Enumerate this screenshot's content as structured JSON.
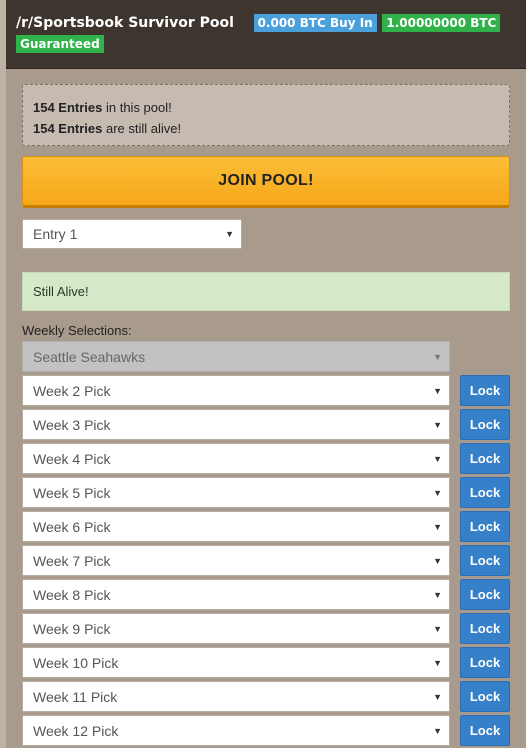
{
  "header": {
    "title": "/r/Sportsbook Survivor Pool",
    "buy_in": "0.000 BTC Buy In",
    "guaranteed_amount": "1.00000000 BTC",
    "guaranteed_label": "Guaranteed"
  },
  "info": {
    "entries_count": "154 Entries",
    "entries_text": " in this pool!",
    "alive_count": "154 Entries",
    "alive_text": " are still alive!"
  },
  "join_button": "JOIN POOL!",
  "entry_select": {
    "selected": "Entry 1"
  },
  "status": "Still Alive!",
  "weekly": {
    "label": "Weekly Selections:",
    "locked_pick": "Seattle Seahawks",
    "lock_label": "Lock",
    "picks": [
      "Week 2 Pick",
      "Week 3 Pick",
      "Week 4 Pick",
      "Week 5 Pick",
      "Week 6 Pick",
      "Week 7 Pick",
      "Week 8 Pick",
      "Week 9 Pick",
      "Week 10 Pick",
      "Week 11 Pick",
      "Week 12 Pick"
    ]
  },
  "icons": {
    "dropdown": "chevron-down-icon"
  },
  "colors": {
    "header_bg": "#3e352e",
    "buy_in_badge": "#4ba0dc",
    "guaranteed_badge": "#2fb24a",
    "join_button": "#f6a819",
    "alive_bg": "#d5e8c8",
    "lock_button": "#3580c8"
  }
}
